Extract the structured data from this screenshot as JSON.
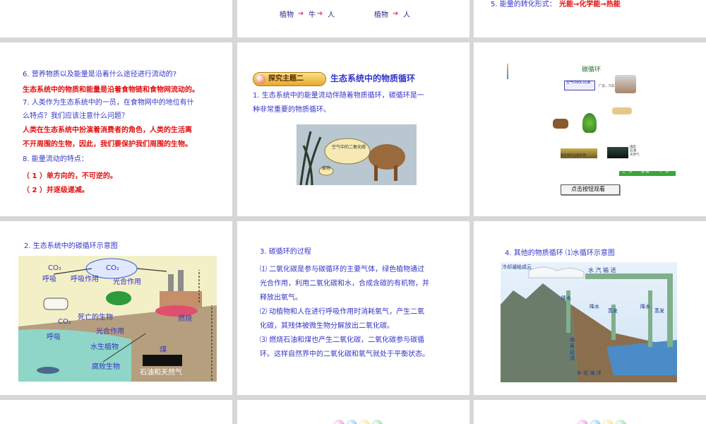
{
  "slide_top_center": {
    "chain_a": "植物",
    "chain_a2": "牛",
    "chain_a3": "人",
    "chain_b": "植物",
    "chain_b2": "人"
  },
  "slide_top_right": {
    "energy_prefix": "5. 能量的转化形式：",
    "energy_value": "光能→化学能→热能"
  },
  "slide_qa": {
    "q6": "6. 营养物质以及能量是沿着什么途径进行流动的?",
    "a6": "生态系统中的物质和能量是沿着食物链和食物网流动的。",
    "q7a": "7. 人类作为生态系统中的一员，在食物网中的地位有什",
    "q7b": "么特点？我们应该注意什么问题？",
    "a7a": "人类在生态系统中扮演着消费者的角色，人类的生活离",
    "a7b": "不开周围的生物，因此，我们要保护我们周围的生物。",
    "q8": "8. 能量流动的特点：",
    "a8a": "（ 1 ）单方向的，不可逆的。",
    "a8b": "（ 2 ）并逐级递减。"
  },
  "slide_theme": {
    "badge": "探究主题二",
    "title": "生态系统中的物质循环",
    "p1a": "1. 生态系统中的能量流动伴随着物质循环，碳循环是一",
    "p1b": "种非常重要的物质循环。",
    "bubble": "空气中的二氧化碳",
    "small_label": "废物"
  },
  "slide_anim": {
    "title": "碳循环",
    "co2_label": "空气中的CO₂库",
    "factory_label": "厂房、汽车等",
    "soil_label": "微生物的分解作用",
    "coal_label": "煤炭 石油 天然气",
    "nav_prev": "上一步",
    "nav_replay": "重 播",
    "nav_next": "下一步",
    "watch_button": "点击按钮观看"
  },
  "slide_diagram": {
    "title": "2. 生态系统中的碳循环示意图",
    "co2_top": "CO₂",
    "co2_cloud": "CO₂",
    "respiration": "呼吸",
    "respiration2": "呼吸作用",
    "photosynthesis": "光合作用",
    "dead": "死亡的生物",
    "burning": "燃烧",
    "co2_water": "CO₂",
    "respiration_water": "呼吸",
    "photosynthesis_water": "光合作用",
    "water_plants": "水生植物",
    "coal": "煤",
    "decay": "腐败生物",
    "oil_gas": "石油和天然气"
  },
  "slide_process": {
    "title": "3. 碳循环的过程",
    "l1": "⑴ 二氧化碳是参与碳循环的主要气体，绿色植物通过",
    "l2": "光合作用，利用二氧化碳和水，合成含碳的有机物，并",
    "l3": "释放出氧气。",
    "l4": "⑵ 动植物和人在进行呼吸作用时消耗氧气，产生二氧",
    "l5": "化碳，其残体被微生物分解放出二氧化碳。",
    "l6": "⑶ 燃烧石油和煤也产生二氧化碳，二氧化碳参与碳循",
    "l7": "环。这样自然界中的二氧化碳和氧气就处于平衡状态。"
  },
  "slide_water": {
    "title": "4. 其他的物质循环  ⑴水循环示意图",
    "vapor": "水 汽 输 送",
    "cold": "冷却凝结成云",
    "rain1": "降水",
    "rain2": "降水",
    "evap1": "蒸发",
    "rain3": "降水",
    "evap2": "蒸发",
    "runoff": "地表径流",
    "ocean": "补 给 海 洋"
  },
  "colors": {
    "blue_text": "#3535c8",
    "red_text": "#e01010",
    "background": "#d7d7d7"
  }
}
